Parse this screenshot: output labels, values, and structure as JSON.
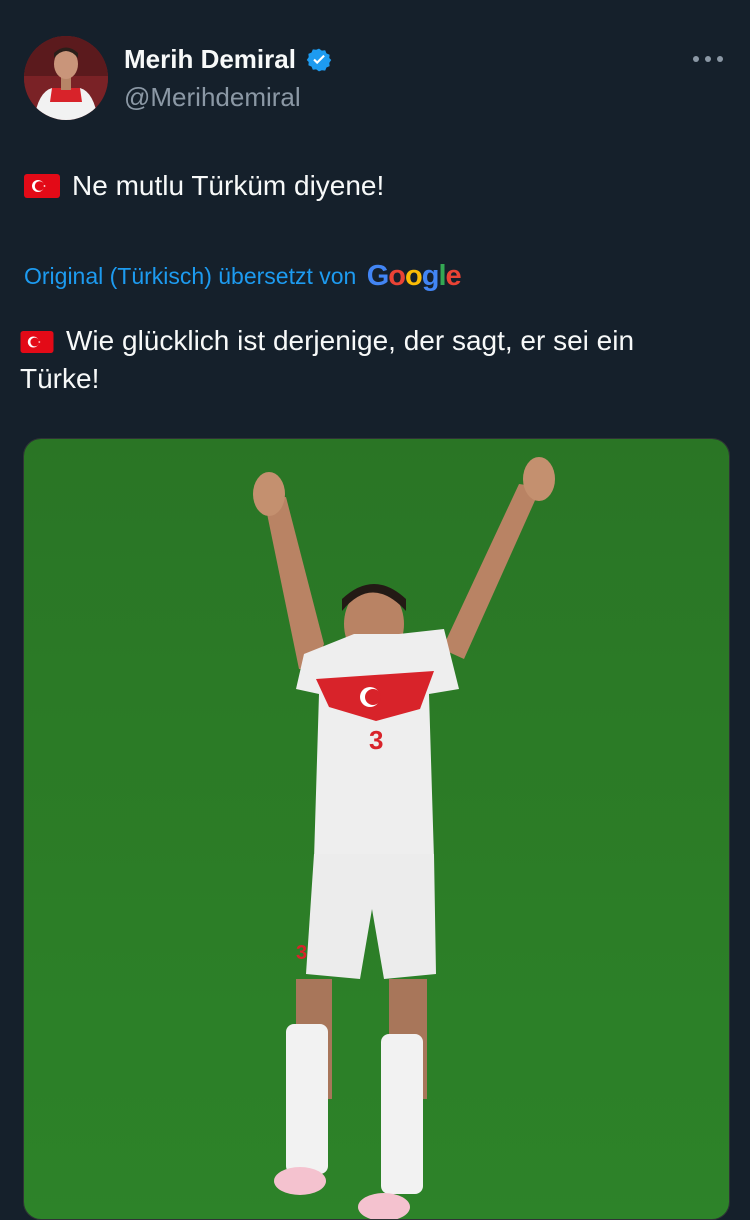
{
  "user": {
    "name": "Merih Demiral",
    "handle": "@Merihdemiral",
    "verified": true
  },
  "tweet": {
    "text": "Ne mutlu Türküm diyene!",
    "flag_icon": "turkey-flag-icon"
  },
  "translation": {
    "label": "Original (Türkisch) übersetzt von",
    "provider": "Google",
    "text": "Wie glücklich ist derjenige, der sagt, er sei ein Türke!"
  },
  "colors": {
    "background": "#15202b",
    "link": "#1d9bf0",
    "muted": "#8b98a5",
    "verified": "#1d9bf0",
    "pitch": "#2f7d2a"
  }
}
